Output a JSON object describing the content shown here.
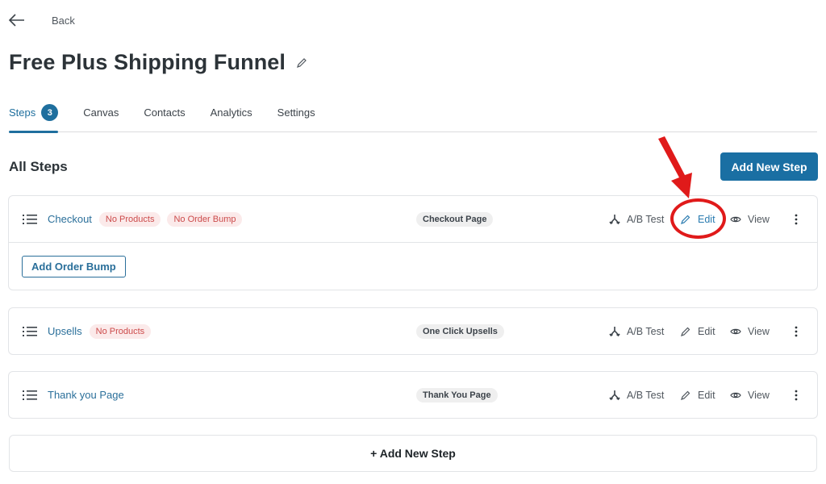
{
  "header": {
    "back_label": "Back",
    "title": "Free Plus Shipping Funnel"
  },
  "tabs": [
    {
      "label": "Steps",
      "badge": "3",
      "active": true
    },
    {
      "label": "Canvas"
    },
    {
      "label": "Contacts"
    },
    {
      "label": "Analytics"
    },
    {
      "label": "Settings"
    }
  ],
  "section": {
    "title": "All Steps",
    "add_button": "Add New Step"
  },
  "steps": [
    {
      "name": "Checkout",
      "badges": [
        "No Products",
        "No Order Bump"
      ],
      "type": "Checkout Page",
      "footer_button": "Add Order Bump"
    },
    {
      "name": "Upsells",
      "badges": [
        "No Products"
      ],
      "type": "One Click Upsells"
    },
    {
      "name": "Thank you Page",
      "badges": [],
      "type": "Thank You Page"
    }
  ],
  "actions": {
    "ab_test": "A/B Test",
    "edit": "Edit",
    "view": "View"
  },
  "add_bottom": "+ Add New Step",
  "colors": {
    "primary": "#1a6fa3",
    "badge_red_bg": "#fbeaea",
    "badge_red_text": "#cc4b4b",
    "annotation": "#e01a1a"
  }
}
